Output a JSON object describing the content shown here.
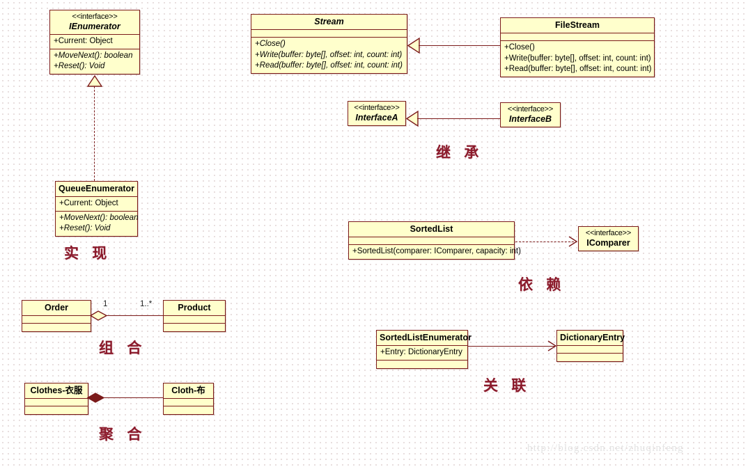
{
  "diagram": {
    "title": "UML Class Relationship Diagram",
    "watermark": "http://blog.csdn.net/zhuqinfeng",
    "colors": {
      "box_fill": "#ffffcc",
      "box_border": "#7b1a1a",
      "line": "#7b1a1a",
      "label": "#8b1a2b",
      "background": "#ffffff"
    }
  },
  "boxes": {
    "ienumerator": {
      "stereotype": "<<interface>>",
      "name": "IEnumerator",
      "attributes": [
        "+Current: Object"
      ],
      "operations": [
        "+MoveNext(): boolean",
        "+Reset(): Void"
      ]
    },
    "queue_enumerator": {
      "stereotype": "",
      "name": "QueueEnumerator",
      "attributes": [
        "+Current: Object"
      ],
      "operations": [
        "+MoveNext(): boolean",
        "+Reset(): Void"
      ]
    },
    "stream": {
      "stereotype": "",
      "name": "Stream",
      "attributes": [],
      "operations": [
        "+Close()",
        "+Write(buffer: byte[], offset: int, count: int)",
        "+Read(buffer: byte[], offset: int, count: int)"
      ]
    },
    "filestream": {
      "stereotype": "",
      "name": "FileStream",
      "attributes": [],
      "operations": [
        "+Close()",
        "+Write(buffer: byte[], offset: int, count: int)",
        "+Read(buffer: byte[], offset: int, count: int)"
      ]
    },
    "interface_a": {
      "stereotype": "<<interface>>",
      "name": "InterfaceA"
    },
    "interface_b": {
      "stereotype": "<<interface>>",
      "name": "InterfaceB"
    },
    "sortedlist": {
      "stereotype": "",
      "name": "SortedList",
      "attributes": [],
      "operations": [
        "+SortedList(comparer: IComparer, capacity: int)"
      ]
    },
    "icomparer": {
      "stereotype": "<<interface>>",
      "name": "IComparer"
    },
    "order": {
      "stereotype": "",
      "name": "Order",
      "attributes": [],
      "operations": []
    },
    "product": {
      "stereotype": "",
      "name": "Product",
      "attributes": [],
      "operations": []
    },
    "sortedlist_enumerator": {
      "stereotype": "",
      "name": "SortedListEnumerator",
      "attributes": [
        "+Entry: DictionaryEntry"
      ],
      "operations": []
    },
    "dictionary_entry": {
      "stereotype": "",
      "name": "DictionaryEntry",
      "attributes": [],
      "operations": []
    },
    "clothes": {
      "stereotype": "",
      "name": "Clothes-衣服",
      "attributes": [],
      "operations": []
    },
    "cloth": {
      "stereotype": "",
      "name": "Cloth-布",
      "attributes": [],
      "operations": []
    }
  },
  "captions": {
    "realization": "实 现",
    "inheritance": "继 承",
    "composition": "组 合",
    "dependency": "依 赖",
    "aggregation": "聚 合",
    "association": "关 联"
  },
  "multiplicities": {
    "order_side": "1",
    "product_side": "1..*"
  }
}
